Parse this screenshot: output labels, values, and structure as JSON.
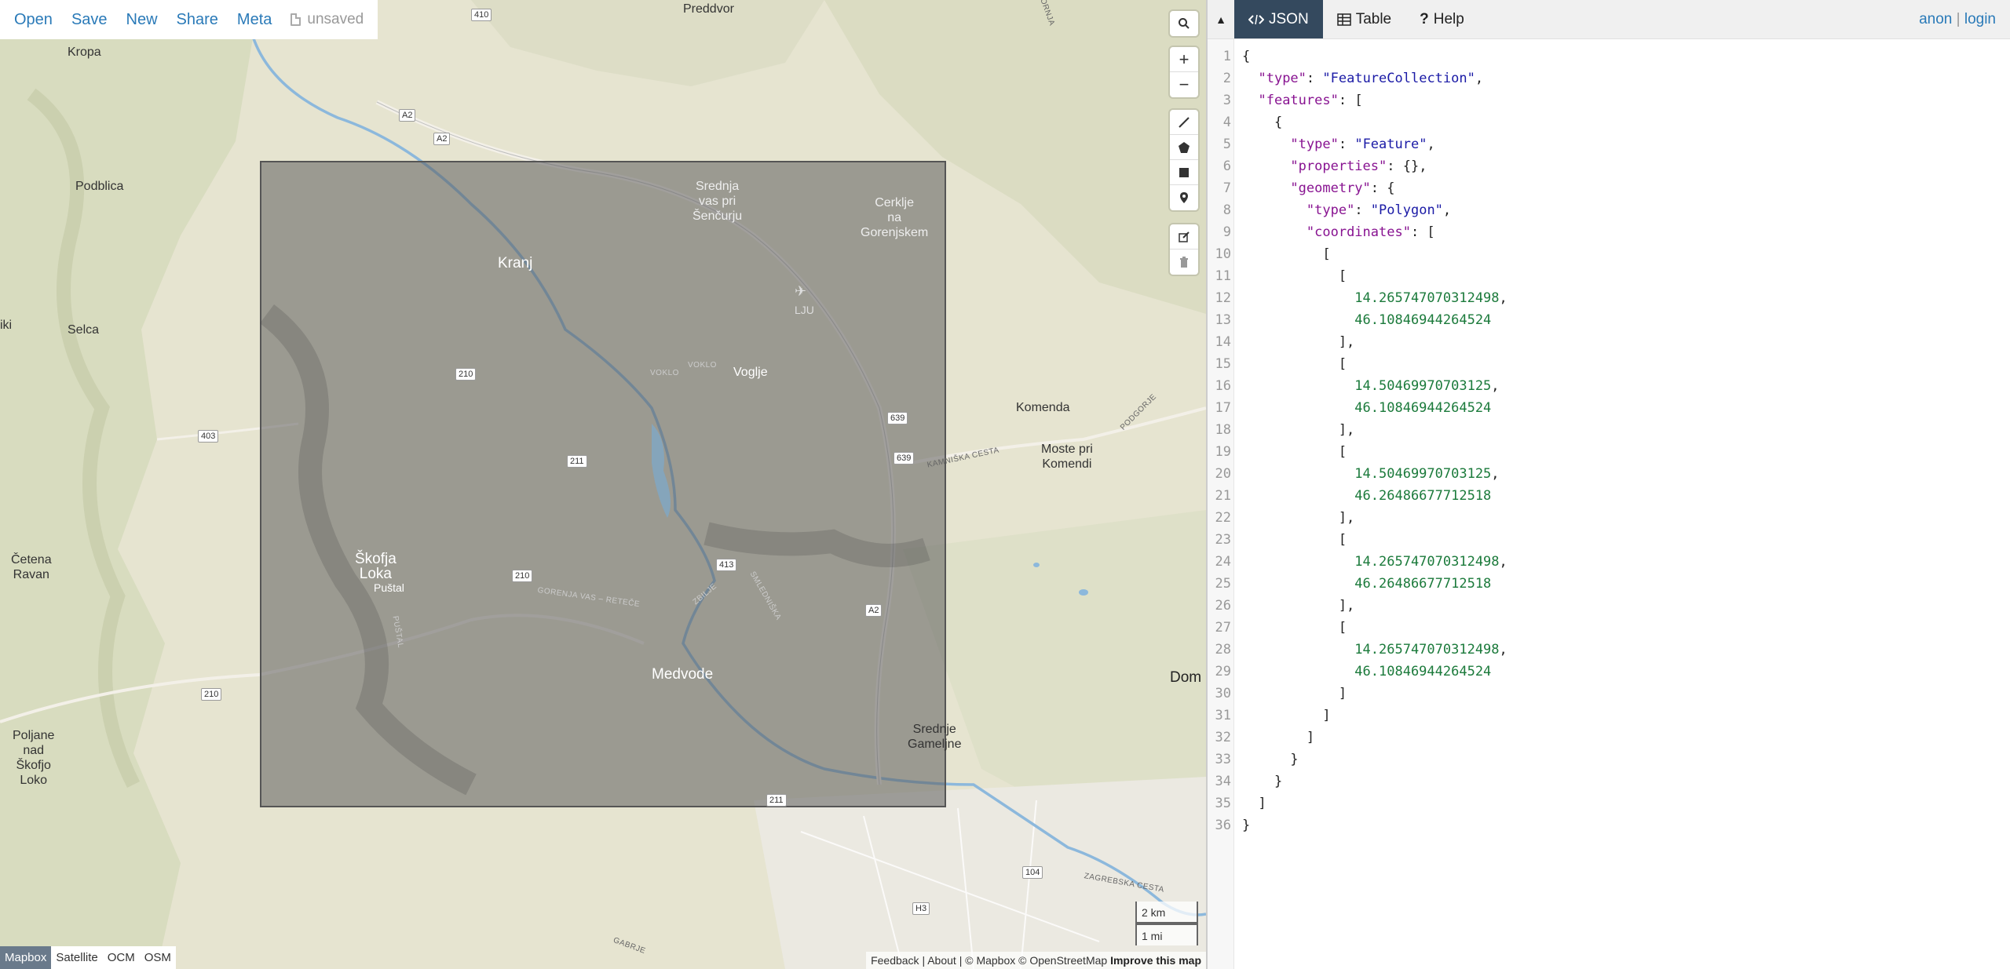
{
  "menu": {
    "open": "Open",
    "save": "Save",
    "new": "New",
    "share": "Share",
    "meta": "Meta",
    "status": "unsaved"
  },
  "map": {
    "places": {
      "preddvor": "Preddvor",
      "kropa": "Kropa",
      "podblica": "Podblica",
      "kranj": "Kranj",
      "srednja_vas": "Srednja\nvas pri\nŠenčurju",
      "cerklje": "Cerklje\nna\nGorenjskem",
      "selca": "Selca",
      "iki": "iki",
      "voglje": "Voglje",
      "komenda": "Komenda",
      "moste": "Moste pri\nKomendi",
      "cetena": "Četena\nRavan",
      "skofja": "Škofja\nLoka",
      "pustal": "Puštal",
      "medvode": "Medvode",
      "poljane": "Poljane\nnad\nŠkofjo\nLoko",
      "srednje_gamelne": "Srednje\nGameljne",
      "dom": "Dom",
      "lju": "LJU"
    },
    "shields": [
      "410",
      "A2",
      "A2",
      "210",
      "211",
      "403",
      "639",
      "639",
      "413",
      "210",
      "210",
      "A2",
      "211",
      "104",
      "H3"
    ],
    "road_labels": [
      "VOKLO",
      "VOKLO",
      "KAMNIŠKA CESTA",
      "GORENJA VAS – RETEČE",
      "ZBILJE",
      "SMLEDNIŠKA",
      "ZAGREBSKA CESTA",
      "GABRJE",
      "PUŠTAL",
      "PODGORJE",
      "GORNJA"
    ],
    "basemaps": [
      "Mapbox",
      "Satellite",
      "OCM",
      "OSM"
    ],
    "active_basemap": "Mapbox",
    "scale_km": "2 km",
    "scale_mi": "1 mi",
    "attribution": {
      "feedback": "Feedback",
      "about": "About",
      "mapbox": "© Mapbox",
      "osm": "© OpenStreetMap",
      "improve": "Improve this map"
    },
    "controls": {
      "search": "search-icon",
      "zoom_in": "+",
      "zoom_out": "−",
      "draw_line": "line-icon",
      "draw_polygon": "polygon-icon",
      "draw_rectangle": "rectangle-icon",
      "draw_marker": "marker-icon",
      "edit": "edit-icon",
      "delete": "trash-icon"
    },
    "selection_polygon": {
      "fill": "#5c5c5c",
      "stroke": "#555555"
    }
  },
  "panel": {
    "tabs": [
      {
        "label": "JSON",
        "icon": "code-icon"
      },
      {
        "label": "Table",
        "icon": "table-icon"
      },
      {
        "label": "Help",
        "icon": "question-icon"
      }
    ],
    "active_tab": "JSON",
    "auth": {
      "anon": "anon",
      "sep": "|",
      "login": "login"
    }
  },
  "editor": {
    "lines": [
      "{",
      "  \"type\": \"FeatureCollection\",",
      "  \"features\": [",
      "    {",
      "      \"type\": \"Feature\",",
      "      \"properties\": {},",
      "      \"geometry\": {",
      "        \"type\": \"Polygon\",",
      "        \"coordinates\": [",
      "          [",
      "            [",
      "              14.265747070312498,",
      "              46.10846944264524",
      "            ],",
      "            [",
      "              14.50469970703125,",
      "              46.10846944264524",
      "            ],",
      "            [",
      "              14.50469970703125,",
      "              46.26486677712518",
      "            ],",
      "            [",
      "              14.265747070312498,",
      "              46.26486677712518",
      "            ],",
      "            [",
      "              14.265747070312498,",
      "              46.10846944264524",
      "            ]",
      "          ]",
      "        ]",
      "      }",
      "    }",
      "  ]",
      "}"
    ]
  }
}
